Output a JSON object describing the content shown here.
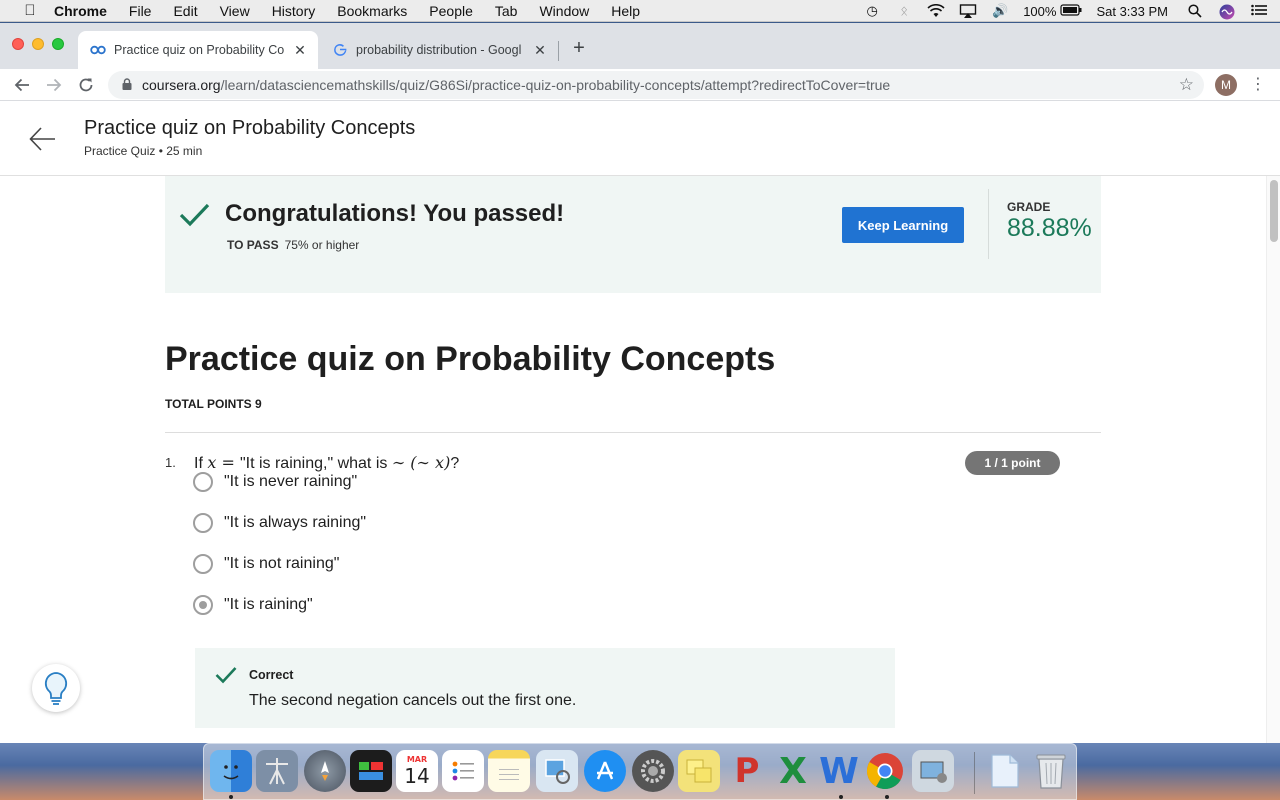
{
  "menubar": {
    "app_name": "Chrome",
    "items": [
      "File",
      "Edit",
      "View",
      "History",
      "Bookmarks",
      "People",
      "Tab",
      "Window",
      "Help"
    ],
    "battery": "100%",
    "clock": "Sat 3:33 PM",
    "status_icons": [
      "time-machine-icon",
      "bluetooth-icon",
      "wifi-icon",
      "airplay-icon",
      "volume-icon",
      "battery-icon",
      "spotlight-icon",
      "siri-icon",
      "notification-center-icon"
    ]
  },
  "tabs": [
    {
      "title": "Practice quiz on Probability Co",
      "favicon": "coursera-icon",
      "active": true
    },
    {
      "title": "probability distribution - Googl",
      "favicon": "google-icon",
      "active": false
    }
  ],
  "toolbar": {
    "url_host": "coursera.org",
    "url_path": "/learn/datasciencemathskills/quiz/G86Si/practice-quiz-on-probability-concepts/attempt?redirectToCover=true",
    "profile_initial": "M"
  },
  "header": {
    "title": "Practice quiz on Probability Concepts",
    "subtitle": "Practice Quiz • 25 min"
  },
  "result": {
    "title": "Congratulations! You passed!",
    "to_pass_label": "TO PASS",
    "to_pass_value": "75% or higher",
    "keep_learning": "Keep Learning",
    "grade_label": "GRADE",
    "grade_value": "88.88%",
    "accent": "#1c7a5a",
    "button_color": "#2073d2"
  },
  "quiz": {
    "title": "Practice quiz on Probability Concepts",
    "total_points": "TOTAL POINTS 9"
  },
  "question": {
    "number": "1.",
    "text_prefix": "If ",
    "var_x": "x",
    "equals": " = ",
    "text_mid": "\"It is raining,\" what is ",
    "expr": "∼ (∼ x)",
    "text_suffix": "?",
    "points": "1 / 1 point",
    "options": [
      {
        "label": "\"It is never raining\"",
        "selected": false
      },
      {
        "label": "\"It is always raining\"",
        "selected": false
      },
      {
        "label": "\"It is not raining\"",
        "selected": false
      },
      {
        "label": "\"It is raining\"",
        "selected": true
      }
    ],
    "feedback": {
      "status": "Correct",
      "text": "The second negation cancels out the first one."
    }
  },
  "dock": {
    "icons": [
      "finder-icon",
      "network-utility-icon",
      "launchpad-icon",
      "activity-monitor-icon",
      "calendar-icon",
      "reminders-icon",
      "notes-icon",
      "preview-icon",
      "app-store-icon",
      "system-preferences-icon",
      "stickies-icon",
      "powerpoint-icon",
      "excel-icon",
      "word-icon",
      "chrome-icon",
      "image-capture-icon",
      "documents-folder-icon",
      "trash-icon"
    ],
    "calendar_month": "MAR",
    "calendar_day": "14"
  }
}
